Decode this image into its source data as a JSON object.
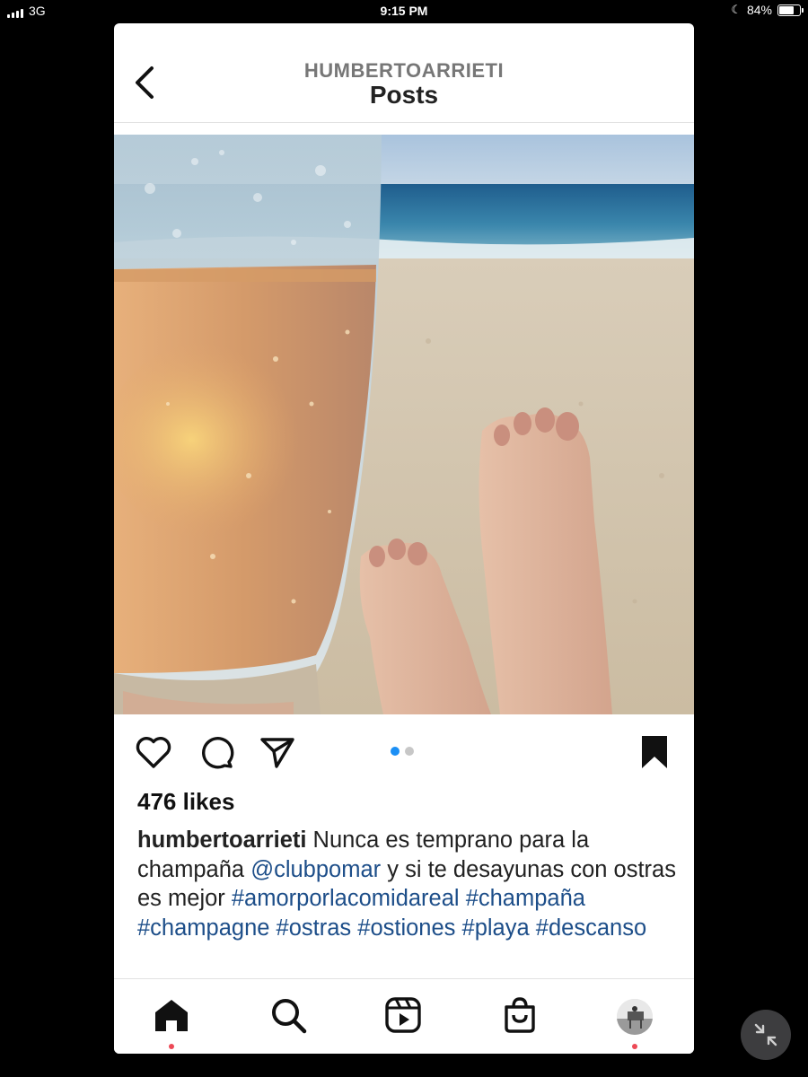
{
  "status_bar": {
    "network": "3G",
    "time": "9:15 PM",
    "battery": "84%",
    "battery_level": 0.84
  },
  "header": {
    "username": "HUMBERTOARRIETI",
    "title": "Posts",
    "back_icon": "chevron-left-icon"
  },
  "post": {
    "photo_description_icon": "photo",
    "carousel": {
      "count": 2,
      "active_index": 0
    },
    "likes": "476 likes",
    "caption": {
      "username": "humbertoarrieti",
      "text_1": "Nunca es temprano para la champaña",
      "mention": "@clubpomar",
      "text_2": "y si te desayunas con ostras es mejor",
      "hashtags": [
        "#amorporlacomidareal",
        "#champaña",
        "#champagne",
        "#ostras",
        "#ostiones",
        "#playa",
        "#descanso"
      ]
    }
  },
  "actions": {
    "like_icon": "heart-icon",
    "comment_icon": "comment-icon",
    "share_icon": "send-icon",
    "save_icon": "bookmark-icon"
  },
  "tab_bar": {
    "items": [
      "home-icon",
      "search-icon",
      "reels-icon",
      "shop-icon",
      "profile-avatar"
    ]
  },
  "colors": {
    "accent": "#1b8ff5",
    "link": "#1d4e89",
    "notification": "#ed4956"
  }
}
